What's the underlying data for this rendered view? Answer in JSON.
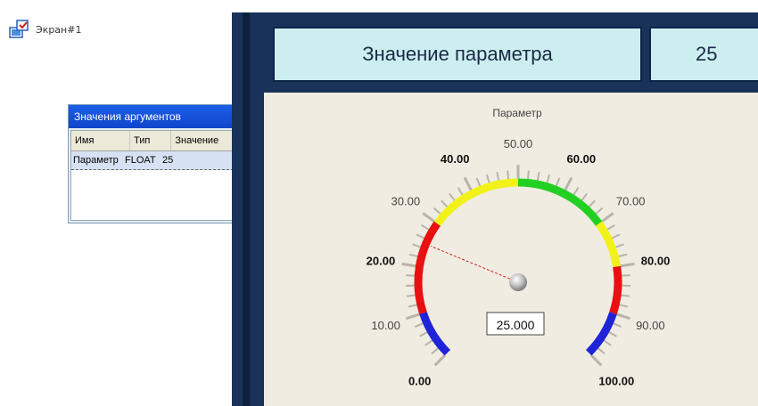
{
  "screen_tree": {
    "label": "Экран#1",
    "icon": "screen-icon"
  },
  "arguments_window": {
    "title": "Значения аргументов",
    "columns": [
      "Имя",
      "Тип",
      "Значение"
    ],
    "rows": [
      {
        "name": "Параметр",
        "type": "FLOAT",
        "value": "25"
      }
    ]
  },
  "hmi": {
    "title": "Значение параметра",
    "value": "25",
    "gauge": {
      "label": "Параметр",
      "min": 0,
      "max": 100,
      "current": 25,
      "readout": "25.000",
      "ticks": [
        "0.00",
        "10.00",
        "20.00",
        "30.00",
        "40.00",
        "50.00",
        "60.00",
        "70.00",
        "80.00",
        "90.00",
        "100.00"
      ],
      "zones": [
        {
          "from": 0,
          "to": 10,
          "color": "#1f24d8"
        },
        {
          "from": 10,
          "to": 30,
          "color": "#e81010"
        },
        {
          "from": 30,
          "to": 50,
          "color": "#f2f21a"
        },
        {
          "from": 50,
          "to": 70,
          "color": "#22d022"
        },
        {
          "from": 70,
          "to": 80,
          "color": "#f2f21a"
        },
        {
          "from": 80,
          "to": 90,
          "color": "#e81010"
        },
        {
          "from": 90,
          "to": 100,
          "color": "#1f24d8"
        }
      ]
    }
  },
  "colors": {
    "panel_dark": "#18325a",
    "panel_light": "#cdeef1",
    "gauge_bg": "#f0ece1"
  }
}
